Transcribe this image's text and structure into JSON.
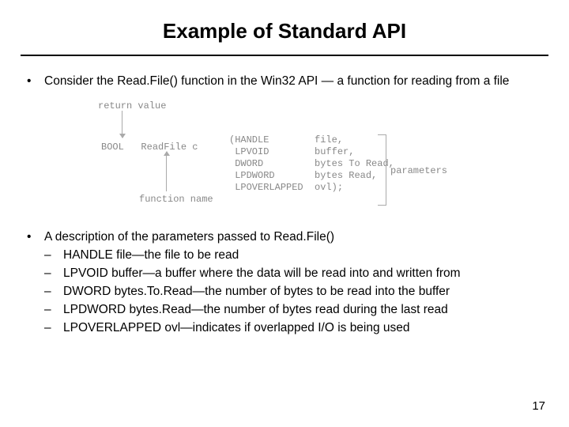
{
  "title": "Example of Standard API",
  "bullets": {
    "intro": "Consider the Read.File() function in the Win32 API — a function for reading from a file",
    "desc": "A description of the parameters passed to Read.File()",
    "subs": {
      "s0": "HANDLE file—the file to be read",
      "s1": "LPVOID buffer—a buffer where the data will be read into and written from",
      "s2": "DWORD bytes.To.Read—the number of bytes to be read into the buffer",
      "s3": "LPDWORD bytes.Read—the number of bytes read during the last read",
      "s4": "LPOVERLAPPED ovl—indicates if overlapped I/O is being used"
    }
  },
  "diagram": {
    "return_label": "return value",
    "fn_label": "function name",
    "params_label": "parameters",
    "bool": "BOOL",
    "fn": "ReadFile c",
    "open": "(HANDLE",
    "p_file": "file,",
    "p1t": "LPVOID",
    "p1n": "buffer,",
    "p2t": "DWORD",
    "p2n": "bytes To Read,",
    "p3t": "LPDWORD",
    "p3n": "bytes Read,",
    "p4t": "LPOVERLAPPED",
    "p4n": "ovl);"
  },
  "page_number": "17",
  "markers": {
    "b1": "•",
    "b2": "–"
  }
}
